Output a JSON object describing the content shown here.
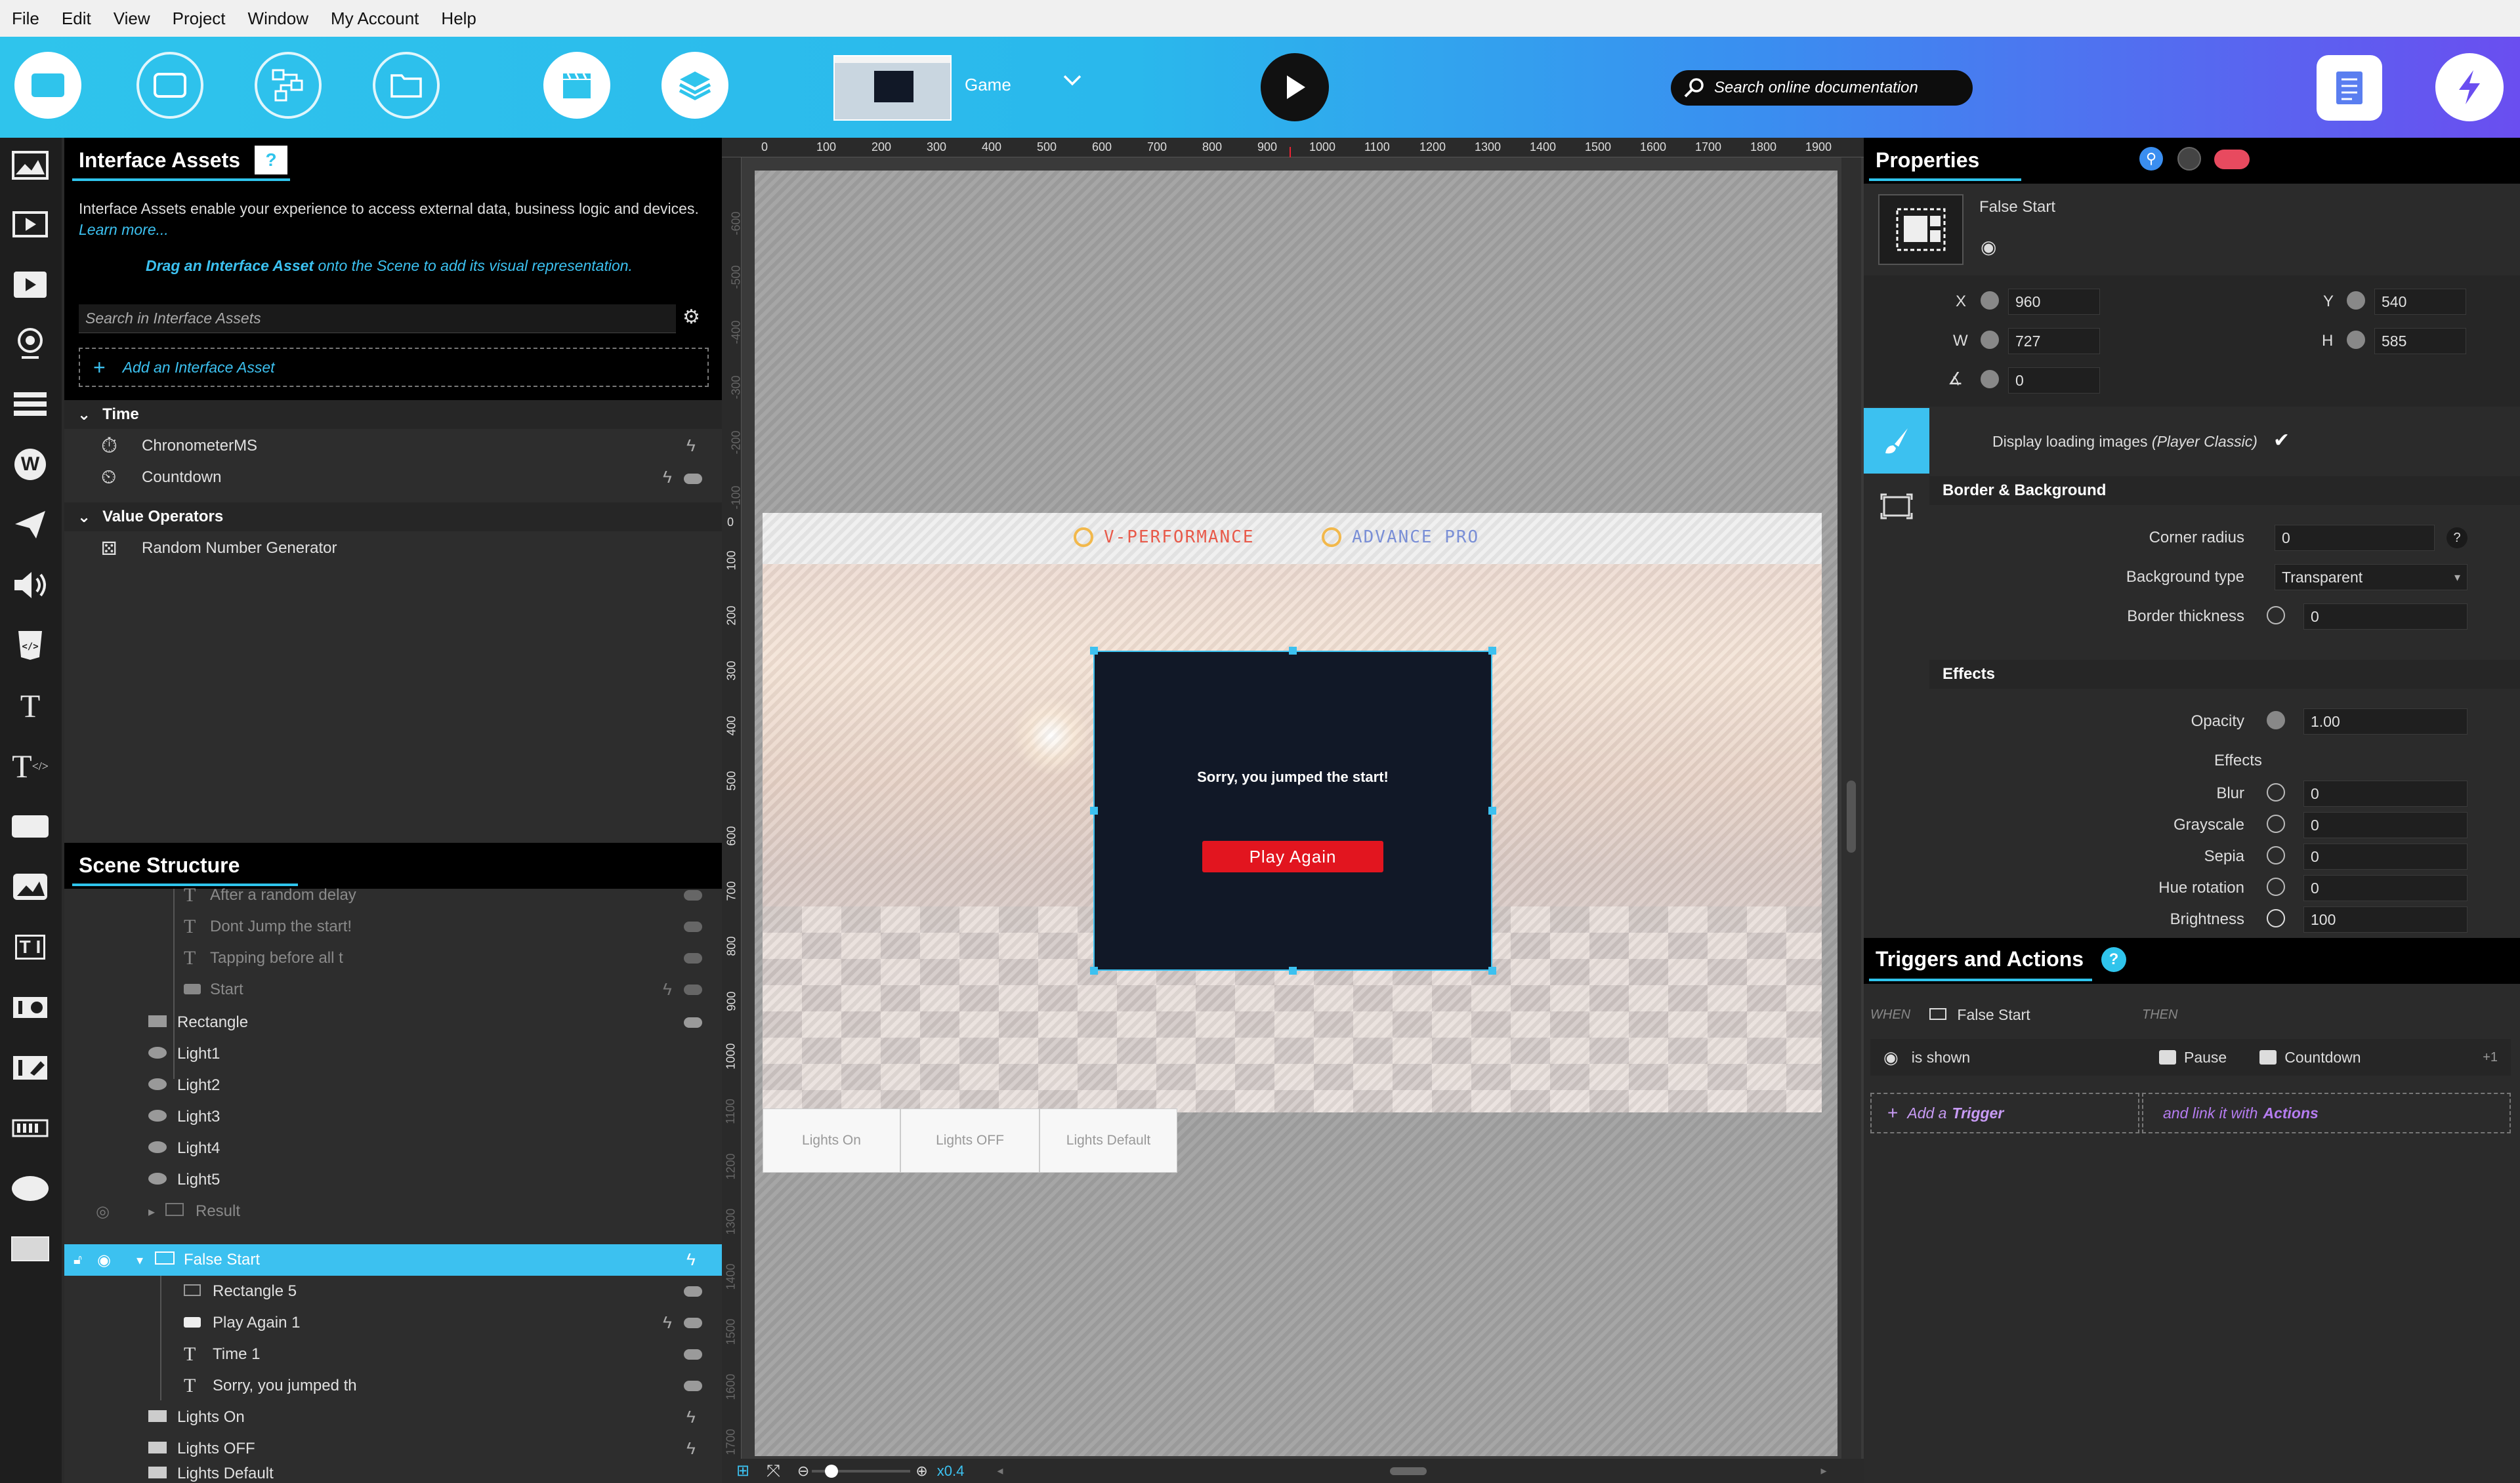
{
  "menu": [
    "File",
    "Edit",
    "View",
    "Project",
    "Window",
    "My Account",
    "Help"
  ],
  "toolbar": {
    "scene_name": "Game",
    "search_placeholder": "Search online documentation"
  },
  "interface_assets": {
    "title": "Interface Assets",
    "help": "?",
    "description": "Interface Assets enable your experience to access external data, business logic and devices.",
    "learn_more": "Learn more...",
    "drag_hint_bold": "Drag an Interface Asset",
    "drag_hint_rest": "onto the Scene to add its visual representation.",
    "search_placeholder": "Search in Interface Assets",
    "add_label": "Add an Interface Asset",
    "groups": [
      {
        "name": "Time",
        "items": [
          "ChronometerMS",
          "Countdown"
        ]
      },
      {
        "name": "Value Operators",
        "items": [
          "Random Number Generator"
        ]
      }
    ]
  },
  "scene_structure": {
    "title": "Scene Structure",
    "rows": [
      "After a random delay",
      "Dont Jump the start!",
      "Tapping before all t",
      "Start",
      "Rectangle",
      "Light1",
      "Light2",
      "Light3",
      "Light4",
      "Light5",
      "Result",
      "False Start",
      "Rectangle 5",
      "Play Again 1",
      "Time 1",
      "Sorry, you jumped th",
      "Lights On",
      "Lights OFF",
      "Lights Default"
    ]
  },
  "canvas": {
    "ruler_top": [
      "0",
      "100",
      "200",
      "300",
      "400",
      "500",
      "600",
      "700",
      "800",
      "900",
      "1000",
      "1100",
      "1200",
      "1300",
      "1400",
      "1500",
      "1600",
      "1700",
      "1800",
      "1900"
    ],
    "ruler_left": [
      "0",
      "100",
      "200",
      "300",
      "400",
      "500",
      "600",
      "700",
      "800",
      "900",
      "1000",
      "1100",
      "1200",
      "1300",
      "1400",
      "1500",
      "1600",
      "1700"
    ],
    "ruler_left_neg": [
      "-600",
      "-500",
      "-400",
      "-300",
      "-200",
      "-100"
    ],
    "logo_left": "V-PERFORMANCE",
    "logo_right": "ADVANCE PRO",
    "popup_message": "Sorry, you jumped the start!",
    "popup_button": "Play Again",
    "buttons_below": [
      "Lights On",
      "Lights OFF",
      "Lights Default"
    ],
    "zoom": "x0.4"
  },
  "properties": {
    "title": "Properties",
    "element_name": "False Start",
    "x_label": "X",
    "x": "960",
    "y_label": "Y",
    "y": "540",
    "w_label": "W",
    "w": "727",
    "h_label": "H",
    "h": "585",
    "rotation": "0",
    "loading_images": "Display loading images",
    "loading_images_note": "(Player Classic)",
    "border_section": "Border & Background",
    "corner_radius_label": "Corner radius",
    "corner_radius": "0",
    "bg_type_label": "Background type",
    "bg_type": "Transparent",
    "border_label": "Border thickness",
    "border": "0",
    "effects_section": "Effects",
    "opacity_label": "Opacity",
    "opacity": "1.00",
    "effects_label": "Effects",
    "blur_label": "Blur",
    "blur": "0",
    "grayscale_label": "Grayscale",
    "grayscale": "0",
    "sepia_label": "Sepia",
    "sepia": "0",
    "hue_label": "Hue rotation",
    "hue": "0",
    "brightness_label": "Brightness",
    "brightness": "100"
  },
  "triggers": {
    "title": "Triggers and Actions",
    "help": "?",
    "when": "WHEN",
    "when_target": "False Start",
    "then": "THEN",
    "trigger": "is shown",
    "action": "Pause",
    "action_target": "Countdown",
    "more": "+1",
    "add_trigger_pre": "Add a",
    "add_trigger_word": "Trigger",
    "link_pre": "and link it with",
    "link_word": "Actions"
  },
  "colors": {
    "accent": "#2fc4ec",
    "selection": "#3cc1f0",
    "popup_bg": "#111827",
    "popup_button": "#e2151f",
    "action_link": "#b57cf0",
    "trigger_link": "#c89bf5"
  }
}
